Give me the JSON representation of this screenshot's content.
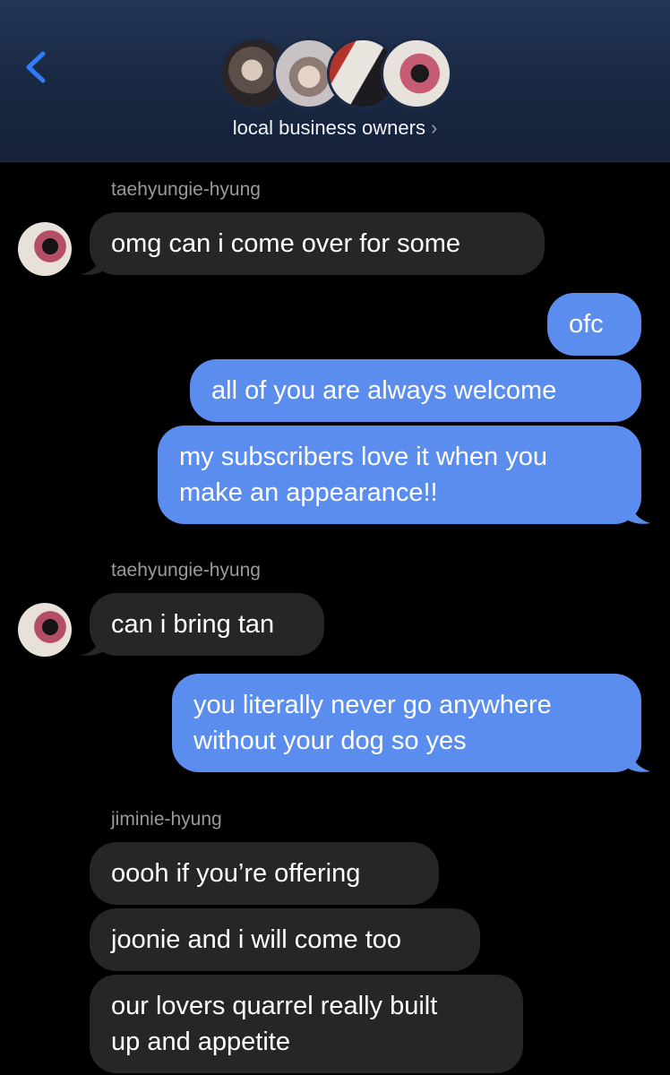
{
  "header": {
    "back_icon": "chevron-left-icon",
    "group_name": "local business owners",
    "chevron": "›",
    "accent": "#2f7cf6"
  },
  "messages": {
    "m1": {
      "sender": "taehyungie-hyung",
      "text": "omg can i come over for some"
    },
    "m2": {
      "text": "ofc"
    },
    "m3": {
      "text": "all of you are always welcome"
    },
    "m4": {
      "text": "my subscribers love it when you make an appearance!!",
      "line1": "my subscribers love it when you",
      "line2": "make an appearance!!"
    },
    "m5": {
      "sender": "taehyungie-hyung",
      "text": "can i bring tan"
    },
    "m6": {
      "text": "you literally never go anywhere without your dog so yes",
      "line1": "you literally never go anywhere",
      "line2": "without your dog so yes"
    },
    "m7": {
      "sender": "jiminie-hyung",
      "text": "oooh if you’re offering"
    },
    "m8": {
      "text": "joonie and i will come too"
    },
    "m9": {
      "text": "our lovers quarrel really built up and appetite",
      "line1": "our lovers quarrel really built",
      "line2": "up and appetite"
    }
  },
  "colors": {
    "incoming_bubble": "#262629",
    "outgoing_bubble": "#5b8def",
    "background": "#000000"
  }
}
